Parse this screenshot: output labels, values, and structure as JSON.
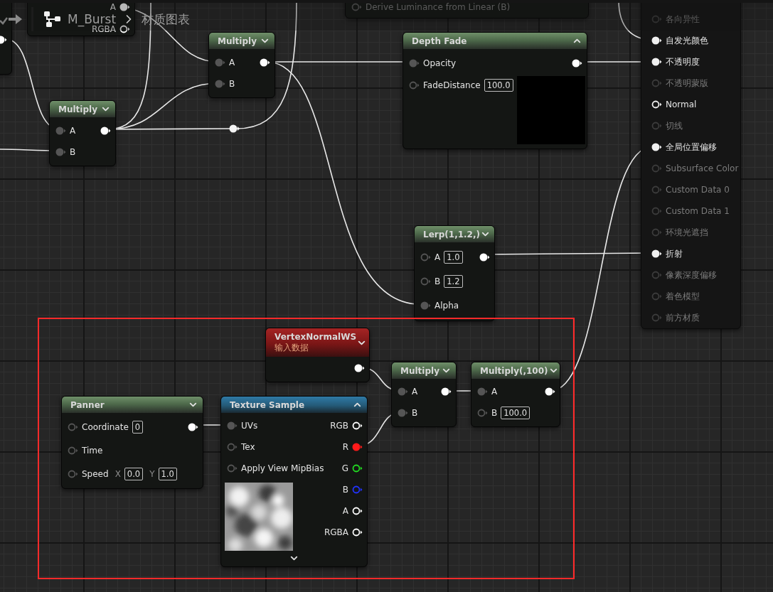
{
  "breadcrumb": {
    "asset": "M_Burst",
    "graph": "材质图表"
  },
  "nodes": [
    {
      "kind": "fragment",
      "rows": [
        {
          "out": {
            "connected": true
          }
        }
      ]
    },
    {
      "kind": "fragment",
      "rows": [
        {
          "out": {
            "label": "A",
            "connected": true
          }
        },
        {
          "out": {
            "label": "RGBA",
            "connected": false
          }
        }
      ]
    },
    {
      "kind": "fragment",
      "rows": [
        {
          "in": {
            "label": "Derive Luminance from Linear (B)",
            "connected": false
          }
        }
      ]
    },
    {
      "kind": "math",
      "title": "Multiply",
      "expanded": false,
      "rows": [
        {
          "in": {
            "label": "A",
            "connected": true
          },
          "out": {
            "connected": true
          }
        },
        {
          "in": {
            "label": "B",
            "connected": true
          }
        }
      ]
    },
    {
      "kind": "math",
      "title": "Multiply",
      "expanded": false,
      "rows": [
        {
          "in": {
            "label": "A",
            "connected": true
          },
          "out": {
            "connected": true
          }
        },
        {
          "in": {
            "label": "B",
            "connected": true
          }
        }
      ]
    },
    {
      "kind": "math",
      "title": "Depth Fade",
      "expanded": true,
      "preview": {
        "kind": "blank"
      },
      "rows": [
        {
          "in": {
            "label": "Opacity",
            "connected": true
          },
          "out": {
            "connected": true
          }
        },
        {
          "in": {
            "label": "FadeDistance",
            "connected": false,
            "fields": [
              {
                "value": "100.0"
              }
            ]
          }
        }
      ]
    },
    {
      "kind": "math",
      "title": "Lerp(1,1.2,)",
      "expanded": false,
      "rows": [
        {
          "in": {
            "label": "A",
            "connected": false,
            "fields": [
              {
                "value": "1.0"
              }
            ]
          },
          "out": {
            "connected": true
          }
        },
        {
          "in": {
            "label": "B",
            "connected": false,
            "fields": [
              {
                "value": "1.2"
              }
            ]
          }
        },
        {
          "in": {
            "label": "Alpha",
            "connected": true
          }
        }
      ]
    },
    {
      "kind": "input",
      "title": "VertexNormalWS",
      "subtitle": "输入数据",
      "expanded": false,
      "rows": [
        {
          "out": {
            "connected": true
          }
        }
      ]
    },
    {
      "kind": "math",
      "title": "Panner",
      "expanded": false,
      "rows": [
        {
          "in": {
            "label": "Coordinate",
            "connected": false,
            "fields": [
              {
                "value": "0"
              }
            ]
          },
          "out": {
            "connected": true
          }
        },
        {
          "in": {
            "label": "Time",
            "connected": false
          }
        },
        {
          "in": {
            "label": "Speed",
            "connected": false,
            "fields": [
              {
                "label": "X",
                "value": "0.0"
              },
              {
                "label": "Y",
                "value": "1.0"
              }
            ]
          }
        }
      ]
    },
    {
      "kind": "texture",
      "title": "Texture Sample",
      "expanded": true,
      "has_more": true,
      "rows": [
        {
          "in": {
            "label": "UVs",
            "connected": true
          },
          "out": {
            "label": "RGB",
            "connected": false,
            "color": "#ffffff"
          }
        },
        {
          "in": {
            "label": "Tex",
            "connected": false
          },
          "out": {
            "label": "R",
            "connected": true,
            "color": "#ff1a1a"
          }
        },
        {
          "in": {
            "label": "Apply View MipBias",
            "connected": false
          },
          "out": {
            "label": "G",
            "connected": false,
            "color": "#22dd22"
          }
        },
        {
          "out": {
            "label": "B",
            "connected": false,
            "color": "#2233ff"
          }
        },
        {
          "out": {
            "label": "A",
            "connected": false,
            "color": "#ffffff"
          }
        },
        {
          "out": {
            "label": "RGBA",
            "connected": false,
            "color": "#ffffff"
          }
        }
      ]
    },
    {
      "kind": "math",
      "title": "Multiply",
      "expanded": false,
      "rows": [
        {
          "in": {
            "label": "A",
            "connected": true
          },
          "out": {
            "connected": true
          }
        },
        {
          "in": {
            "label": "B",
            "connected": true
          }
        }
      ]
    },
    {
      "kind": "math",
      "title": "Multiply(,100)",
      "expanded": false,
      "rows": [
        {
          "in": {
            "label": "A",
            "connected": true
          },
          "out": {
            "connected": true
          }
        },
        {
          "in": {
            "label": "B",
            "connected": false,
            "fields": [
              {
                "value": "100.0"
              }
            ]
          }
        }
      ]
    }
  ],
  "result": {
    "pins": [
      {
        "label": "各向异性",
        "connected": false,
        "disabled": true
      },
      {
        "label": "自发光颜色",
        "connected": true,
        "disabled": false
      },
      {
        "label": "不透明度",
        "connected": true,
        "disabled": false
      },
      {
        "label": "不透明蒙版",
        "connected": false,
        "disabled": true
      },
      {
        "label": "Normal",
        "connected": false,
        "disabled": false
      },
      {
        "label": "切线",
        "connected": false,
        "disabled": true
      },
      {
        "label": "全局位置偏移",
        "connected": true,
        "disabled": false
      },
      {
        "label": "Subsurface Color",
        "connected": false,
        "disabled": true
      },
      {
        "label": "Custom Data 0",
        "connected": false,
        "disabled": true
      },
      {
        "label": "Custom Data 1",
        "connected": false,
        "disabled": true
      },
      {
        "label": "环境光遮挡",
        "connected": false,
        "disabled": true
      },
      {
        "label": "折射",
        "connected": true,
        "disabled": false
      },
      {
        "label": "像素深度偏移",
        "connected": false,
        "disabled": true
      },
      {
        "label": "着色模型",
        "connected": false,
        "disabled": true
      },
      {
        "label": "前方材质",
        "connected": false,
        "disabled": true
      }
    ]
  },
  "highlight_frame": true
}
